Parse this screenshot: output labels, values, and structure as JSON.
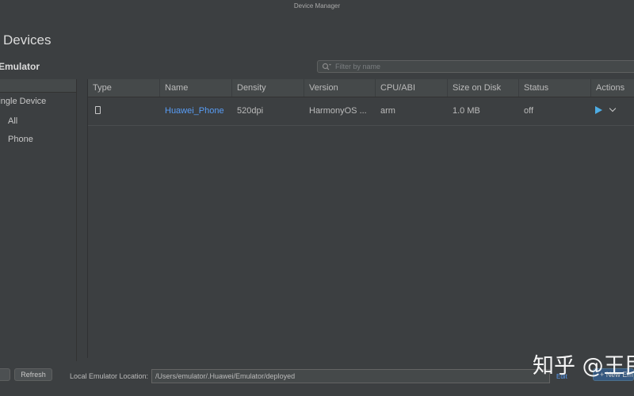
{
  "window": {
    "title": "Device Manager"
  },
  "header": {
    "page_title": "Devices",
    "section_title": "Emulator"
  },
  "search": {
    "placeholder": "Filter by name"
  },
  "sidebar": {
    "items": [
      {
        "label": "Single Device"
      },
      {
        "label": "All"
      },
      {
        "label": "Phone"
      }
    ]
  },
  "table": {
    "columns": [
      "Type",
      "Name",
      "Density",
      "Version",
      "CPU/ABI",
      "Size on Disk",
      "Status",
      "Actions"
    ],
    "rows": [
      {
        "type_icon": "phone-icon",
        "name": "Huawei_Phone",
        "density": "520dpi",
        "version": "HarmonyOS ...",
        "cpu_abi": "arm",
        "size_on_disk": "1.0 MB",
        "status": "off",
        "actions": [
          "play-icon",
          "chevron-down-icon"
        ]
      }
    ]
  },
  "bottom": {
    "left_button_label": "",
    "refresh_label": "Refresh",
    "location_label": "Local Emulator Location:",
    "location_value": "/Users/emulator/.Huawei/Emulator/deployed",
    "edit_label": "Edit",
    "new_emulator_label": "+ New Emulator"
  },
  "watermark": {
    "text": "知乎 @王民"
  },
  "colors": {
    "background": "#3c3f41",
    "header_bg": "#45494a",
    "link": "#589df6",
    "play": "#4eade5",
    "primary_button": "#365880"
  }
}
